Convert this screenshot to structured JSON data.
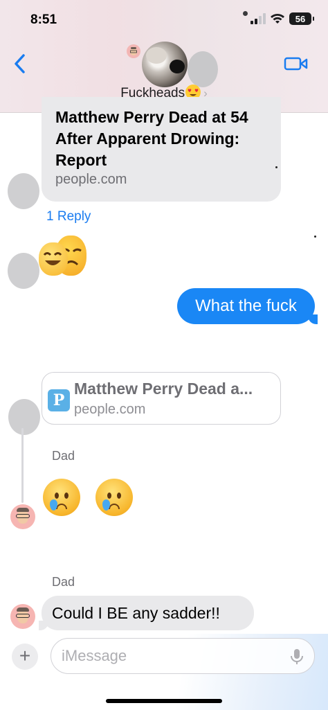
{
  "status_bar": {
    "time": "8:51",
    "battery": "56"
  },
  "header": {
    "group_name": "Fuckheads"
  },
  "messages": {
    "link_preview_top": {
      "title": "Matthew Perry Dead at 54 After Apparent Drowing: Report",
      "domain": "people.com"
    },
    "reply_count": "1 Reply",
    "sent_text": "What the fuck",
    "link_preview_reply": {
      "icon_letter": "P",
      "title": "Matthew Perry Dead a...",
      "domain": "people.com"
    },
    "sender_1": "Dad",
    "sender_2": "Dad",
    "dad_text": "Could I BE any sadder!!"
  },
  "input": {
    "placeholder": "iMessage",
    "plus_label": "+"
  },
  "colors": {
    "sent_bubble": "#1a87f5",
    "received_bubble": "#e9e9eb",
    "link_blue": "#1a7cf0"
  },
  "icons": [
    "back-chevron-icon",
    "video-call-icon",
    "microphone-icon",
    "plus-icon",
    "heart-eyes-emoji",
    "theater-masks-emoji",
    "crying-face-emoji",
    "memoji-avatar"
  ]
}
